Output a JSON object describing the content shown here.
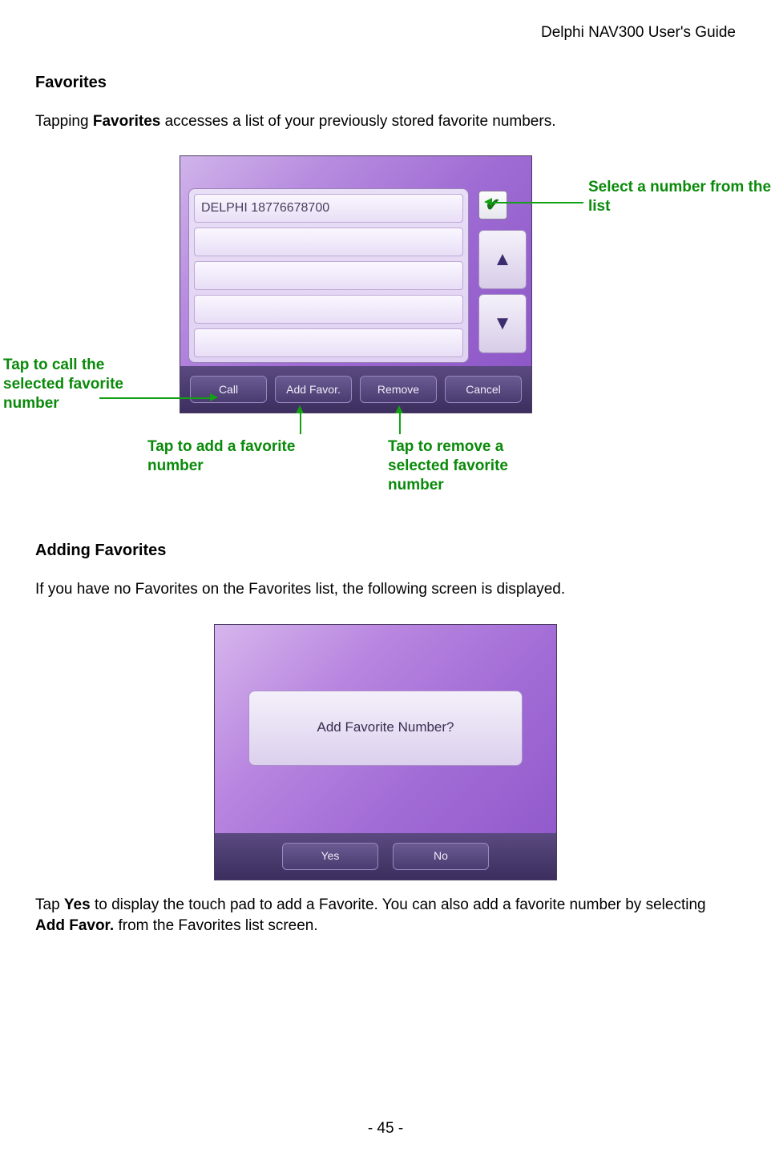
{
  "header": {
    "guide_title": "Delphi NAV300 User's Guide"
  },
  "section1": {
    "title": "Favorites",
    "intro_pre": "Tapping ",
    "intro_bold": "Favorites",
    "intro_post": " accesses a list of your previously stored favorite numbers."
  },
  "screen1": {
    "list_item": "DELPHI 18776678700",
    "check_glyph": "✔",
    "up_glyph": "▲",
    "down_glyph": "▼",
    "buttons": {
      "call": "Call",
      "add": "Add Favor.",
      "remove": "Remove",
      "cancel": "Cancel"
    }
  },
  "annotations": {
    "select": "Select a number from the list",
    "call": "Tap to call the selected favorite number",
    "add": "Tap to add a favorite number",
    "remove": "Tap to remove a selected favorite number"
  },
  "section2": {
    "title": "Adding Favorites",
    "intro": "If you have no Favorites on the Favorites list, the following screen is displayed."
  },
  "screen2": {
    "dialog_text": "Add Favorite Number?",
    "yes": "Yes",
    "no": "No"
  },
  "closing": {
    "pre": "Tap ",
    "bold1": "Yes",
    "mid": " to display the touch pad to add a Favorite.  You can also add a favorite number by selecting ",
    "bold2": "Add Favor.",
    "post": " from the Favorites list screen."
  },
  "page_number": "- 45 -"
}
